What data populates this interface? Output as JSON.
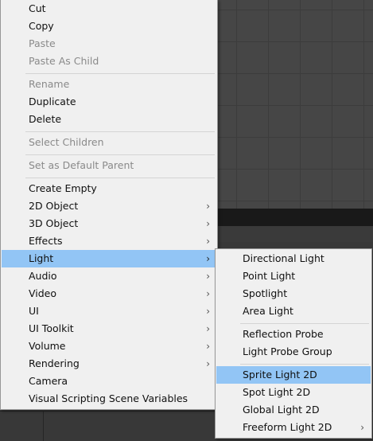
{
  "main_menu": {
    "items": [
      {
        "label": "Cut"
      },
      {
        "label": "Copy"
      },
      {
        "label": "Paste"
      },
      {
        "label": "Paste As Child"
      },
      {
        "label": "Rename"
      },
      {
        "label": "Duplicate"
      },
      {
        "label": "Delete"
      },
      {
        "label": "Select Children"
      },
      {
        "label": "Set as Default Parent"
      },
      {
        "label": "Create Empty"
      },
      {
        "label": "2D Object"
      },
      {
        "label": "3D Object"
      },
      {
        "label": "Effects"
      },
      {
        "label": "Light"
      },
      {
        "label": "Audio"
      },
      {
        "label": "Video"
      },
      {
        "label": "UI"
      },
      {
        "label": "UI Toolkit"
      },
      {
        "label": "Volume"
      },
      {
        "label": "Rendering"
      },
      {
        "label": "Camera"
      },
      {
        "label": "Visual Scripting Scene Variables"
      }
    ],
    "disabled_items": [
      "Paste",
      "Paste As Child",
      "Rename",
      "Select Children",
      "Set as Default Parent"
    ],
    "highlighted_item": "Light"
  },
  "light_submenu": {
    "items": [
      {
        "label": "Directional Light"
      },
      {
        "label": "Point Light"
      },
      {
        "label": "Spotlight"
      },
      {
        "label": "Area Light"
      },
      {
        "label": "Reflection Probe"
      },
      {
        "label": "Light Probe Group"
      },
      {
        "label": "Sprite Light 2D"
      },
      {
        "label": "Spot Light 2D"
      },
      {
        "label": "Global Light 2D"
      },
      {
        "label": "Freeform Light 2D"
      }
    ],
    "highlighted_item": "Sprite Light 2D"
  },
  "icons": {
    "submenu_arrow": "chevron-right-icon",
    "glyph": "›"
  },
  "colors": {
    "menu_bg": "#f0f0f0",
    "highlight": "#92c5f5",
    "disabled_text": "#8a8a8a"
  }
}
